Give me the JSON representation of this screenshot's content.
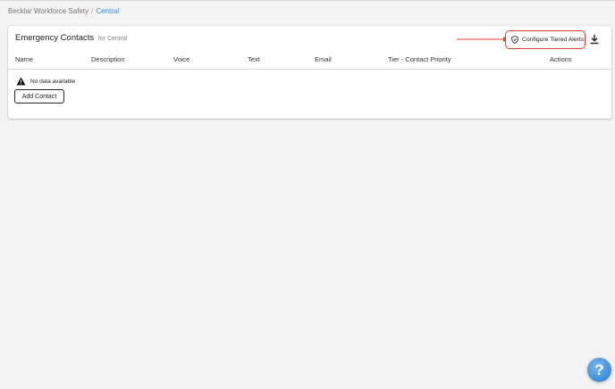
{
  "breadcrumb": {
    "parent": "Becklar Workforce Safety",
    "separator": "/",
    "current": "Central"
  },
  "card": {
    "title": "Emergency Contacts",
    "subtitle": "for Central",
    "tiered_alerts_label": "Configure Tiered Alerts",
    "tiered_alerts_icon": "shield-icon",
    "download_icon": "download-icon",
    "annotation_color": "#e0412b"
  },
  "table": {
    "columns": [
      "Name",
      "Description",
      "Voice",
      "Text",
      "Email",
      "Tier - Contact Priority",
      "Actions"
    ],
    "empty_message": "No data available",
    "empty_icon": "warning-icon"
  },
  "add_contact_label": "Add Contact",
  "help": {
    "label": "?",
    "icon": "help-icon",
    "color": "#3d8bd9"
  }
}
